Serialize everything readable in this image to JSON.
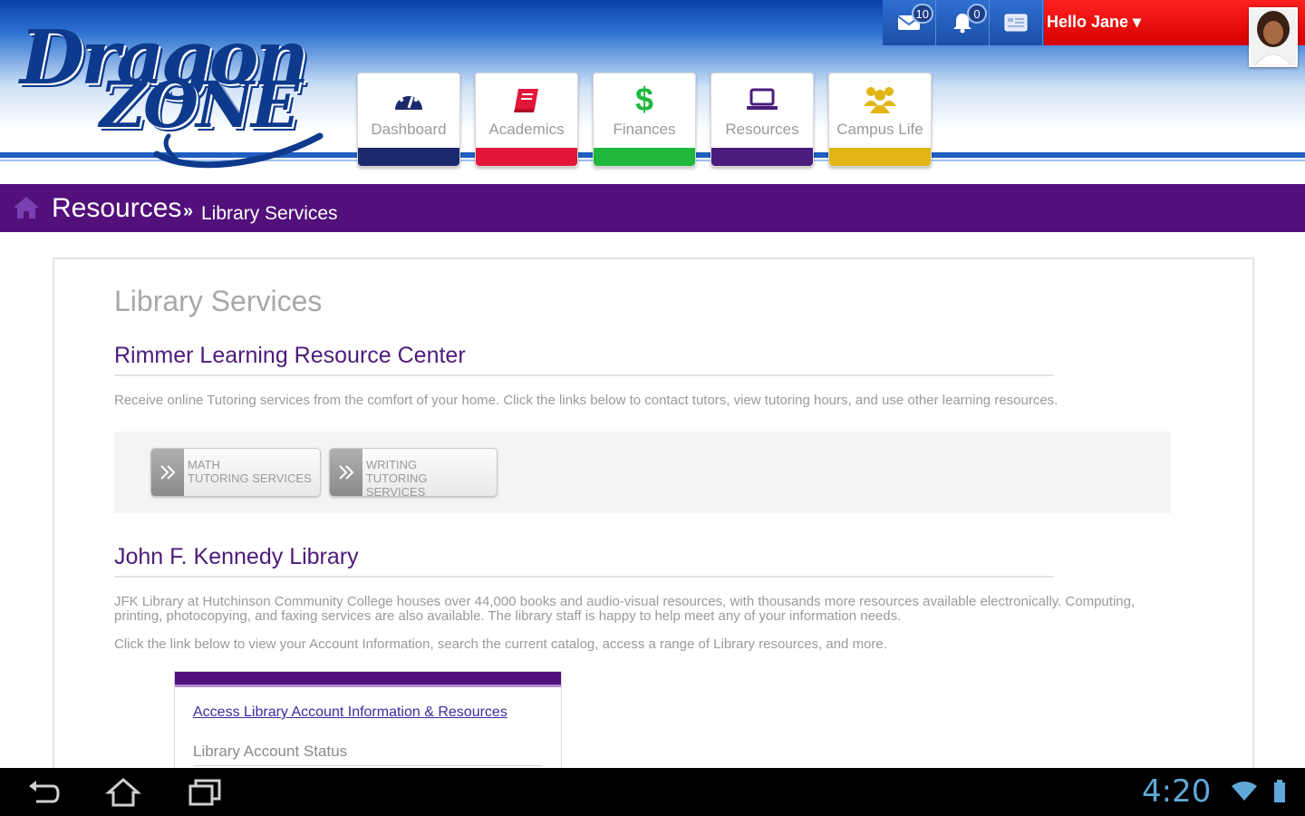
{
  "header": {
    "logo_line1": "Dragon",
    "logo_line2": "ZONE",
    "greeting": "Hello Jane",
    "messages_count": "10",
    "notifications_count": "0"
  },
  "nav": {
    "items": [
      {
        "label": "Dashboard",
        "icon": "dashboard-gauge-icon",
        "color": "#1a2a6c"
      },
      {
        "label": "Academics",
        "icon": "book-icon",
        "color": "#e3173a"
      },
      {
        "label": "Finances",
        "icon": "dollar-icon",
        "color": "#1fb83c"
      },
      {
        "label": "Resources",
        "icon": "laptop-icon",
        "color": "#4b1c7c"
      },
      {
        "label": "Campus Life",
        "icon": "people-icon",
        "color": "#e2b514"
      }
    ]
  },
  "breadcrumb": {
    "section": "Resources",
    "separator": "»",
    "page": "Library Services"
  },
  "content": {
    "title": "Library Services",
    "rimmer": {
      "heading": "Rimmer Learning Resource Center",
      "text": "Receive online Tutoring services from the comfort of your home. Click the links below to contact tutors, view tutoring hours, and use other learning resources.",
      "buttons": [
        {
          "line1": "Math",
          "line2": "Tutoring Services"
        },
        {
          "line1": "Writing",
          "line2": "Tutoring Services"
        }
      ]
    },
    "jfk": {
      "heading": "John F. Kennedy Library",
      "text1": "JFK Library at Hutchinson Community College houses over 44,000 books and audio-visual resources, with thousands more resources available electronically. Computing, printing, photocopying, and faxing services are also available. The library staff is happy to help meet any of your information needs.",
      "text2": "Click the link below to view your Account Information, search the current catalog, access a range of Library resources, and more.",
      "link": "Access Library Account Information & Resources",
      "status_label": "Library Account Status"
    }
  },
  "system_bar": {
    "clock": "4:20"
  },
  "colors": {
    "purple": "#52107a",
    "red": "#e00000",
    "blue": "#1b4fa8"
  }
}
